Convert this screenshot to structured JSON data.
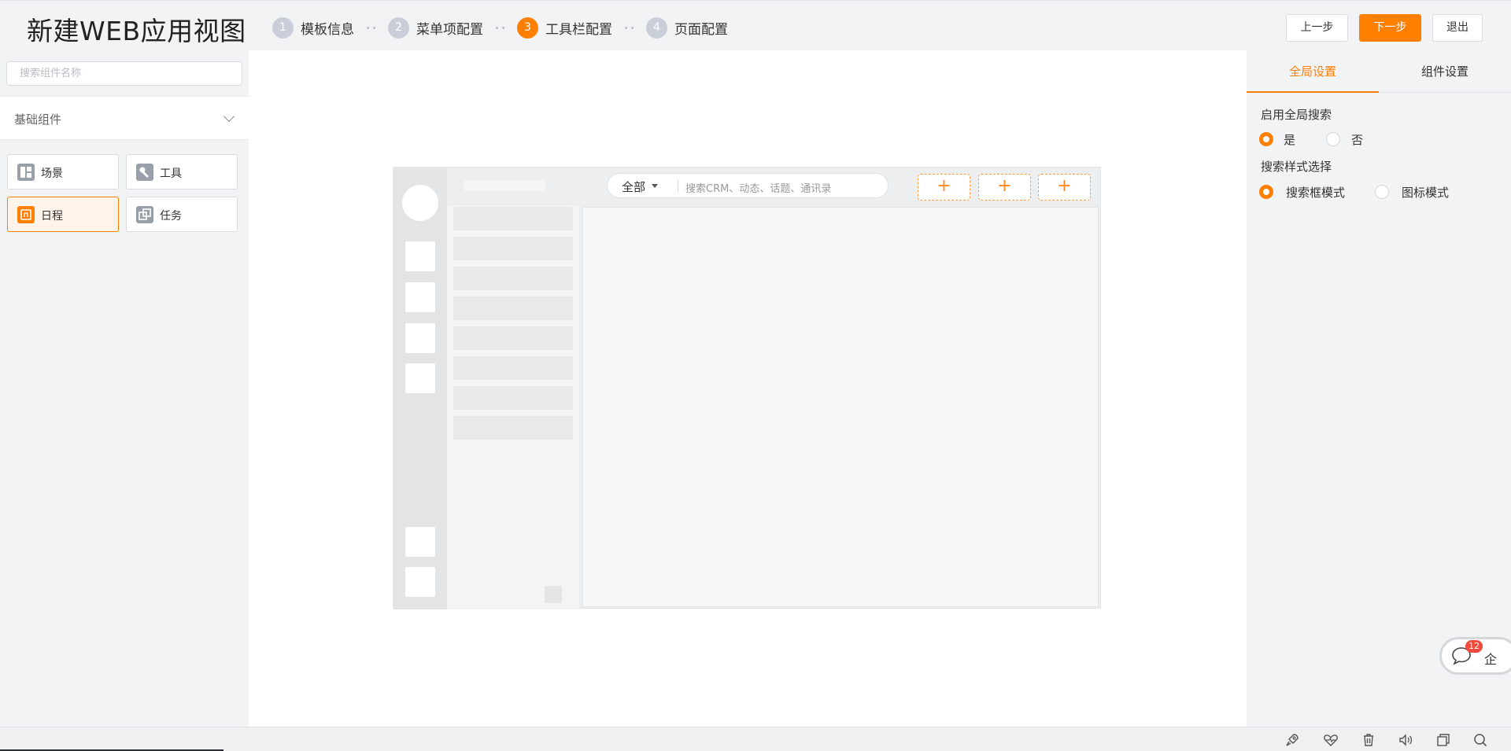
{
  "header": {
    "title": "新建WEB应用视图",
    "steps": [
      {
        "num": "1",
        "label": "模板信息"
      },
      {
        "num": "2",
        "label": "菜单项配置"
      },
      {
        "num": "3",
        "label": "工具栏配置"
      },
      {
        "num": "4",
        "label": "页面配置"
      }
    ],
    "active_step": 3,
    "prev_label": "上一步",
    "next_label": "下一步",
    "exit_label": "退出"
  },
  "left": {
    "search_placeholder": "搜索组件名称",
    "group_label": "基础组件",
    "components": [
      {
        "label": "场景",
        "icon": "scene-icon"
      },
      {
        "label": "工具",
        "icon": "tool-icon"
      },
      {
        "label": "日程",
        "icon": "schedule-icon",
        "selected": true
      },
      {
        "label": "任务",
        "icon": "task-icon"
      }
    ]
  },
  "preview": {
    "scope_label": "全部",
    "search_placeholder": "搜索CRM、动态、话题、通讯录",
    "add_slot_label": "+"
  },
  "right": {
    "tabs": [
      "全局设置",
      "组件设置"
    ],
    "active_tab": 0,
    "global_search": {
      "title": "启用全局搜索",
      "options": [
        "是",
        "否"
      ],
      "selected": "是"
    },
    "search_style": {
      "title": "搜索样式选择",
      "options": [
        "搜索框模式",
        "图标模式"
      ],
      "selected": "搜索框模式"
    }
  },
  "chat_widget": {
    "badge": "12",
    "text": "企"
  },
  "colors": {
    "accent": "#ff7f00",
    "badge": "#f24a3c"
  }
}
